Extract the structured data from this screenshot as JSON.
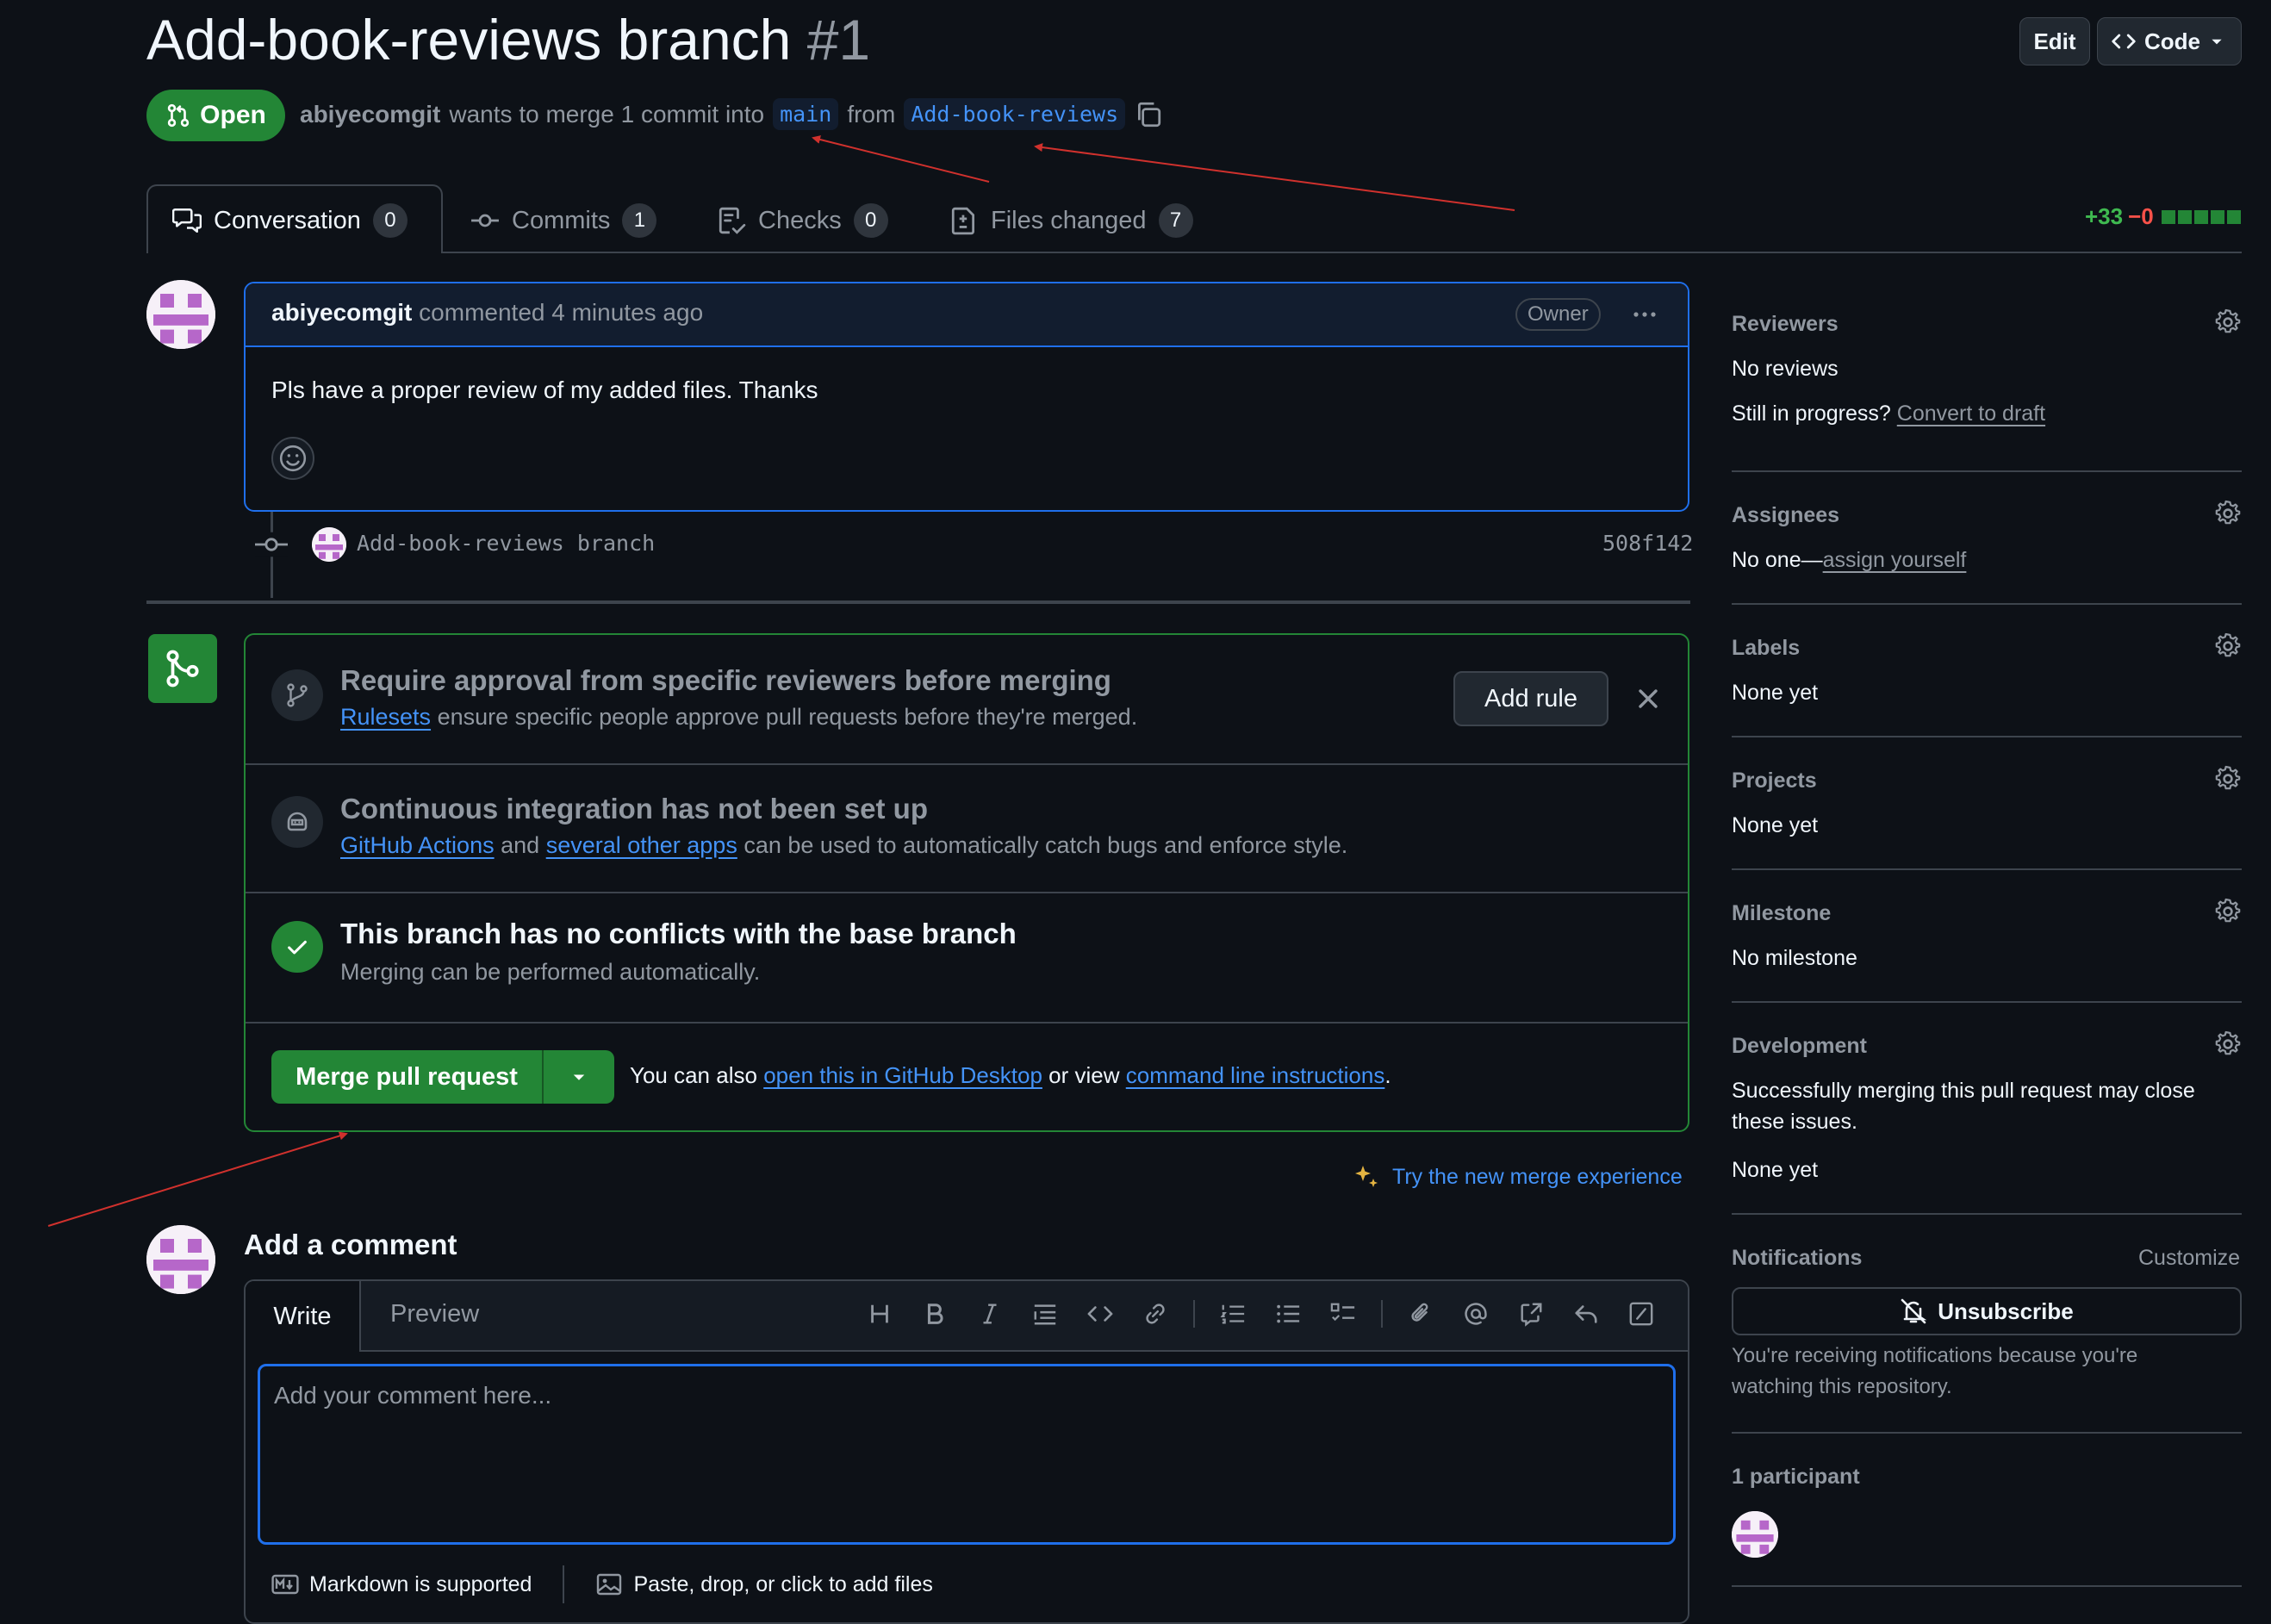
{
  "pr": {
    "title": "Add-book-reviews branch",
    "number": "#1",
    "state": "Open",
    "author": "abiyecomgit",
    "merge_text_1": "wants to merge 1 commit into",
    "base_branch": "main",
    "merge_text_2": "from",
    "head_branch": "Add-book-reviews"
  },
  "header_buttons": {
    "edit": "Edit",
    "code": "Code"
  },
  "tabs": [
    {
      "label": "Conversation",
      "count": "0"
    },
    {
      "label": "Commits",
      "count": "1"
    },
    {
      "label": "Checks",
      "count": "0"
    },
    {
      "label": "Files changed",
      "count": "7"
    }
  ],
  "diffstat": {
    "additions": "+33",
    "deletions": "−0",
    "blocks": 5
  },
  "comment": {
    "author": "abiyecomgit",
    "action": "commented",
    "time": "4 minutes ago",
    "badge": "Owner",
    "body": "Pls have a proper review of my added files. Thanks"
  },
  "commit": {
    "message": "Add-book-reviews branch",
    "sha": "508f142"
  },
  "merge_box": {
    "rule": {
      "title": "Require approval from specific reviewers before merging",
      "link": "Rulesets",
      "text": "ensure specific people approve pull requests before they're merged.",
      "button": "Add rule"
    },
    "ci": {
      "title": "Continuous integration has not been set up",
      "link1": "GitHub Actions",
      "and": "and",
      "link2": "several other apps",
      "text": "can be used to automatically catch bugs and enforce style."
    },
    "conflicts": {
      "title": "This branch has no conflicts with the base branch",
      "text": "Merging can be performed automatically."
    },
    "merge_button": "Merge pull request",
    "alt_1": "You can also",
    "alt_link1": "open this in GitHub Desktop",
    "alt_2": "or view",
    "alt_link2": "command line instructions",
    "alt_3": "."
  },
  "new_merge_link": "Try the new merge experience",
  "add_comment": {
    "title": "Add a comment",
    "tab_write": "Write",
    "tab_preview": "Preview",
    "placeholder": "Add your comment here...",
    "markdown_note": "Markdown is supported",
    "files_note": "Paste, drop, or click to add files"
  },
  "sidebar": {
    "reviewers": {
      "heading": "Reviewers",
      "value": "No reviews",
      "progress_q": "Still in progress?",
      "progress_link": "Convert to draft"
    },
    "assignees": {
      "heading": "Assignees",
      "value": "No one—",
      "link": "assign yourself"
    },
    "labels": {
      "heading": "Labels",
      "value": "None yet"
    },
    "projects": {
      "heading": "Projects",
      "value": "None yet"
    },
    "milestone": {
      "heading": "Milestone",
      "value": "No milestone"
    },
    "development": {
      "heading": "Development",
      "text_1": "Successfully merging this pull request may close",
      "text_2": "these issues.",
      "value": "None yet"
    },
    "notifications": {
      "heading": "Notifications",
      "customize": "Customize",
      "button": "Unsubscribe",
      "reason_1": "You're receiving notifications because you're",
      "reason_2": "watching this repository."
    },
    "participants": {
      "heading": "1 participant"
    }
  },
  "colors": {
    "accent": "#238636",
    "link": "#4493f8",
    "focus": "#1f6feb",
    "annotation": "#d0312d"
  }
}
